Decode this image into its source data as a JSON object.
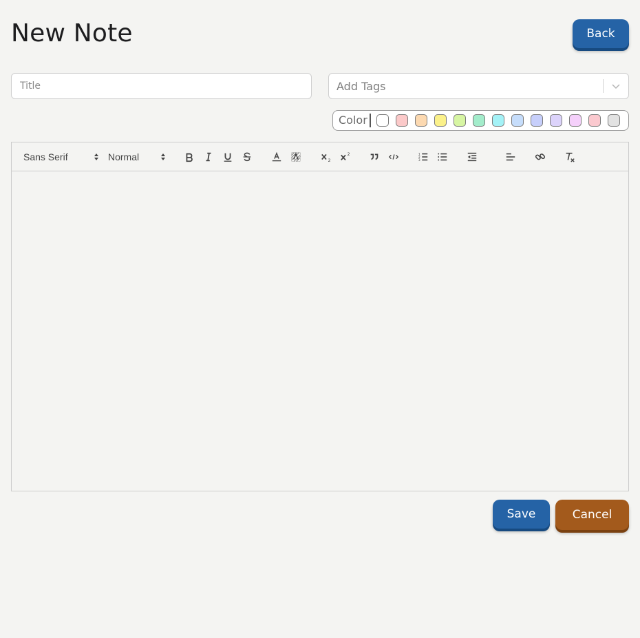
{
  "page": {
    "title": "New Note"
  },
  "header": {
    "back_label": "Back"
  },
  "form": {
    "title_placeholder": "Title",
    "tags_placeholder": "Add Tags",
    "color_label": "Color",
    "swatch_colors": [
      "#ffffff",
      "#fbc9c9",
      "#fcd9b1",
      "#fbf18a",
      "#d7f5a3",
      "#a3eccb",
      "#a4f2f7",
      "#c6ddfb",
      "#c7cffb",
      "#dcd3fb",
      "#f5d0fb",
      "#fbc9cf",
      "#e2e2e2"
    ]
  },
  "toolbar": {
    "font_value": "Sans Serif",
    "size_value": "Normal",
    "icons": [
      "bold-icon",
      "italic-icon",
      "underline-icon",
      "strike-icon",
      "text-color-icon",
      "background-color-icon",
      "subscript-icon",
      "superscript-icon",
      "blockquote-icon",
      "code-block-icon",
      "ordered-list-icon",
      "bullet-list-icon",
      "outdent-icon",
      "align-icon",
      "link-icon",
      "clear-format-icon"
    ]
  },
  "actions": {
    "save_label": "Save",
    "cancel_label": "Cancel"
  },
  "colors": {
    "primary": "#2563a6",
    "secondary": "#a35a1c",
    "background": "#f4f4f2"
  }
}
